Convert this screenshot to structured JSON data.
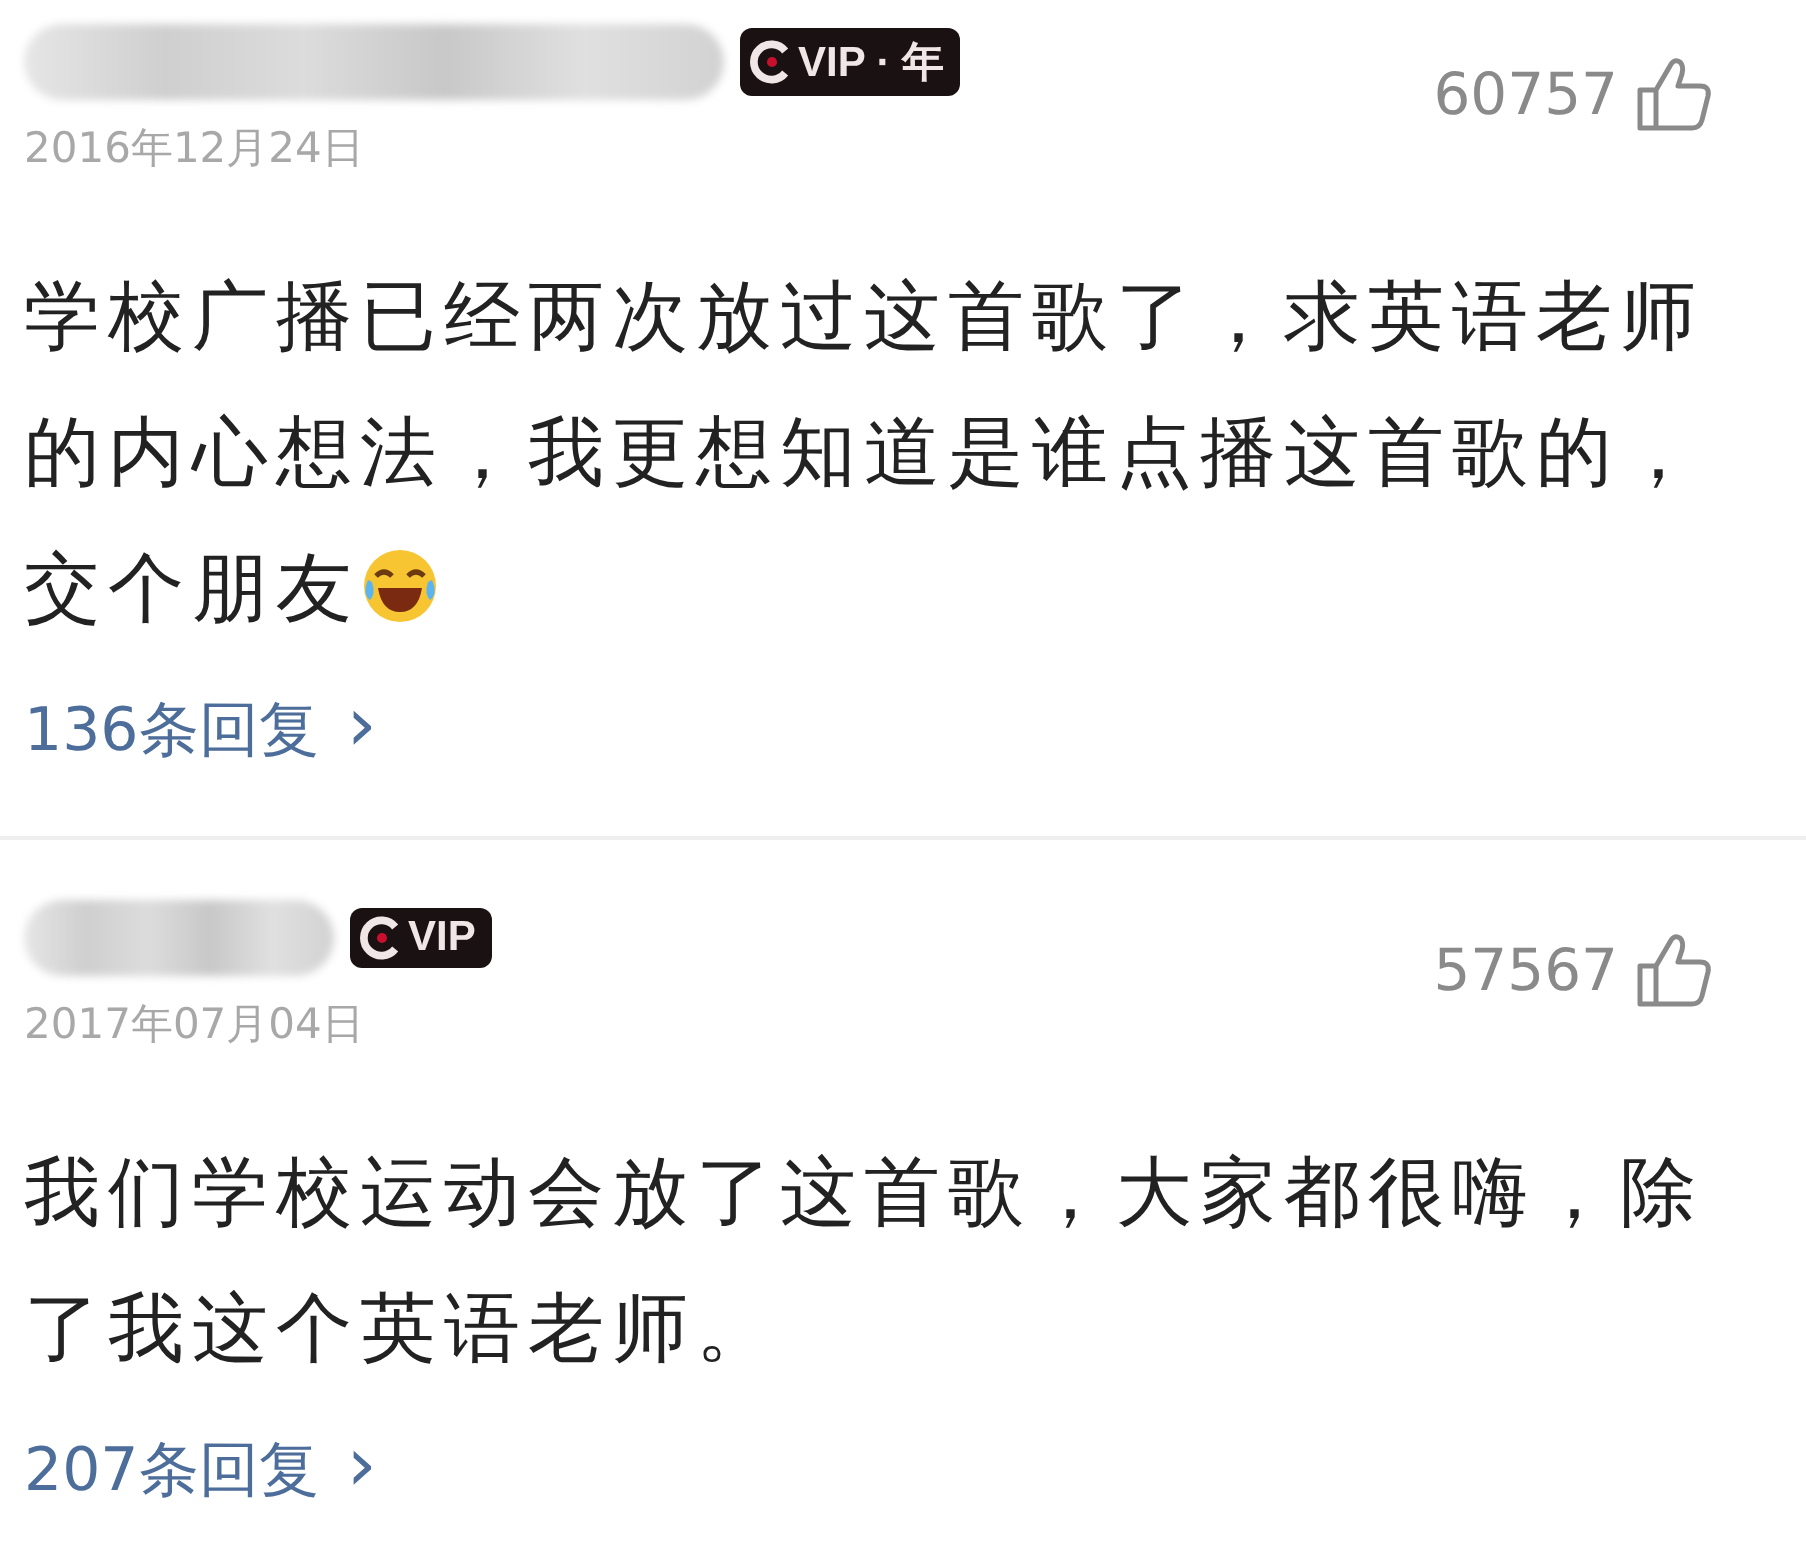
{
  "comments": [
    {
      "badge": "VIP · 年",
      "date": "2016年12月24日",
      "likes": "60757",
      "text": "学校广播已经两次放过这首歌了，求英语老师的内心想法，我更想知道是谁点播这首歌的，交个朋友",
      "emoji": true,
      "replies": "136条回复",
      "reply_arrow": "›"
    },
    {
      "badge": "VIP",
      "date": "2017年07月04日",
      "likes": "57567",
      "text": "我们学校运动会放了这首歌，大家都很嗨，除了我这个英语老师。",
      "emoji": false,
      "replies": "207条回复",
      "reply_arrow": "›"
    }
  ]
}
